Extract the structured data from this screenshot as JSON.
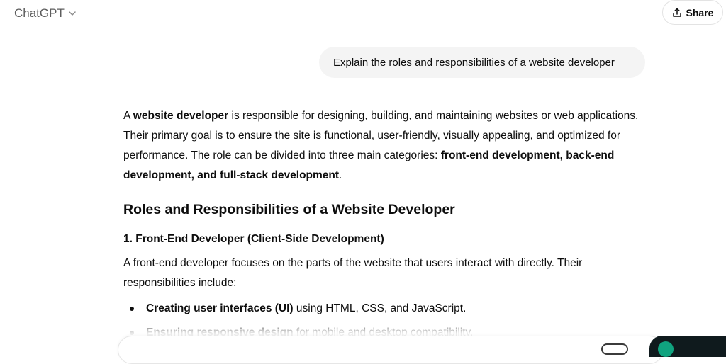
{
  "header": {
    "model_name": "ChatGPT",
    "share_label": "Share"
  },
  "user_message": "Explain the roles and responsibilities of a website developer",
  "response": {
    "intro": {
      "t1": "A ",
      "b1": "website developer",
      "t2": " is responsible for designing, building, and maintaining websites or web applications. Their primary goal is to ensure the site is functional, user-friendly, visually appealing, and optimized for performance. The role can be divided into three main categories: ",
      "b2": "front-end development, back-end development, and full-stack development",
      "t3": "."
    },
    "heading": "Roles and Responsibilities of a Website Developer",
    "section1_title": "1. Front-End Developer (Client-Side Development)",
    "section1_intro": "A front-end developer focuses on the parts of the website that users interact with directly. Their responsibilities include:",
    "bullets": [
      {
        "bold": "Creating user interfaces (UI)",
        "text": " using HTML, CSS, and JavaScript."
      },
      {
        "bold": "Ensuring responsive design",
        "text": " for mobile and desktop compatibility."
      }
    ]
  },
  "colors": {
    "user_bubble_bg": "#f4f4f4",
    "text": "#0d0d0d",
    "muted": "#5d5d5d",
    "accent": "#10a37f"
  }
}
